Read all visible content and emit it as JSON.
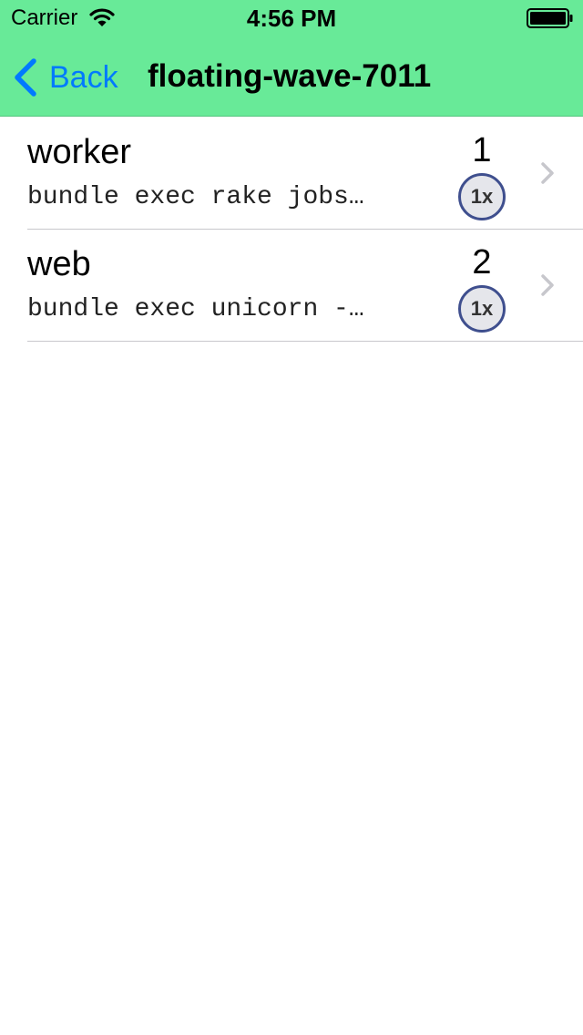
{
  "status_bar": {
    "carrier": "Carrier",
    "time": "4:56 PM",
    "wifi_icon": "wifi-icon",
    "battery_icon": "battery-full-icon"
  },
  "nav": {
    "back_label": "Back",
    "back_icon": "chevron-left-icon",
    "title": "floating-wave-7011"
  },
  "colors": {
    "nav_background": "#68EA98",
    "accent": "#007AFF",
    "badge_border": "#3F4F8E",
    "badge_fill": "#E5E6EB",
    "separator": "#C8C7CC",
    "chevron": "#C7C7CC"
  },
  "process_list": [
    {
      "name": "worker",
      "command": "bundle exec rake jobs…",
      "count": "1",
      "size": "1x"
    },
    {
      "name": "web",
      "command": "bundle exec unicorn -…",
      "count": "2",
      "size": "1x"
    }
  ]
}
